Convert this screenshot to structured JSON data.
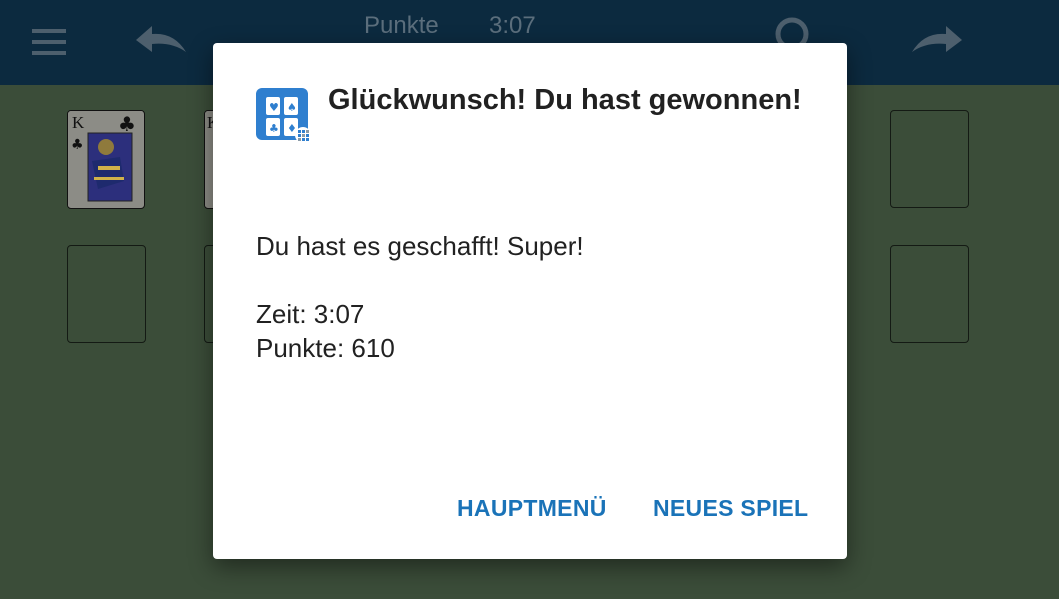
{
  "topbar": {
    "menu_icon": "hamburger-menu-icon",
    "undo_icon": "undo-arrow-icon",
    "hint_icon": "search-hint-icon",
    "redo_icon": "redo-arrow-icon",
    "score_label": "Punkte",
    "time_value": "3:07"
  },
  "board": {
    "visible_card": {
      "rank": "K",
      "suit": "♣"
    },
    "partial_card": {
      "rank": "K"
    }
  },
  "dialog": {
    "app_icon": "card-game-app-icon",
    "title": "Glückwunsch! Du hast gewonnen!",
    "message": "Du hast es geschafft! Super!",
    "time_line": "Zeit: 3:07",
    "score_line": "Punkte: 610",
    "buttons": {
      "main_menu": "HAUPTMENÜ",
      "new_game": "NEUES SPIEL"
    }
  },
  "colors": {
    "topbar": "#0c2a3f",
    "table": "#3b4d39",
    "accent": "#1a73b8",
    "app_icon_blue": "#2f7fcf"
  }
}
